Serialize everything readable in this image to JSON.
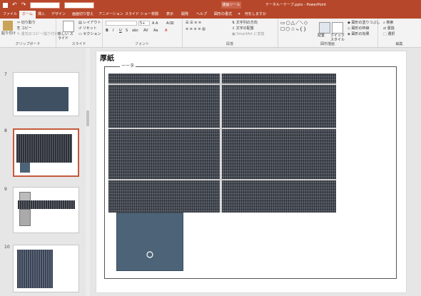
{
  "titlebar": {
    "undo": "↶",
    "redo": "↷",
    "context_tool": "描画ツール",
    "doc_title": "テーネルーテーブ.pptx - PowerPoint"
  },
  "tabs": {
    "file": "ファイル",
    "home": "ホーム",
    "insert": "挿入",
    "design": "デザイン",
    "transitions": "画面切り替え",
    "animations": "アニメーション",
    "slideshow": "スライド ショー",
    "review": "校閲",
    "view": "表示",
    "developer": "開発",
    "help": "ヘルプ",
    "format": "図形の書式",
    "tellme": "何をしますか"
  },
  "ribbon": {
    "clipboard": {
      "paste": "貼り付け",
      "cut": "切り取り",
      "copy": "コピー",
      "format_painter": "書式のコピー/貼り付け",
      "label": "クリップボード"
    },
    "slides": {
      "new_slide": "新しい スライド",
      "layout": "レイアウト",
      "reset": "リセット",
      "section": "セクション",
      "label": "スライド"
    },
    "font": {
      "font_name": "",
      "font_size": "5+",
      "bold": "B",
      "italic": "I",
      "underline": "U",
      "strike": "S",
      "shadow": "abc",
      "label": "フォント"
    },
    "paragraph": {
      "text_direction": "文字列の方向",
      "align_text": "文字の配置",
      "smartart": "SmartArt に変換",
      "label": "段落"
    },
    "drawing": {
      "arrange": "配置",
      "quick_styles": "クイック スタイル",
      "fill": "図形の塗りつぶし",
      "outline": "図形の枠線",
      "effects": "図形の効果",
      "label": "図形描画"
    },
    "editing": {
      "find": "検索",
      "replace": "置換",
      "select": "選択",
      "label": "編集"
    }
  },
  "sidebar": {
    "slides": [
      {
        "number": "7"
      },
      {
        "number": "8"
      },
      {
        "number": "9"
      },
      {
        "number": "10"
      }
    ]
  },
  "slide": {
    "title": "厚紙",
    "frame_label": "ーータ"
  },
  "colors": {
    "accent": "#b7472a",
    "selected_border": "#c55a3c",
    "grid_fill": "#4a4f58",
    "blue_box": "#4d6377"
  }
}
